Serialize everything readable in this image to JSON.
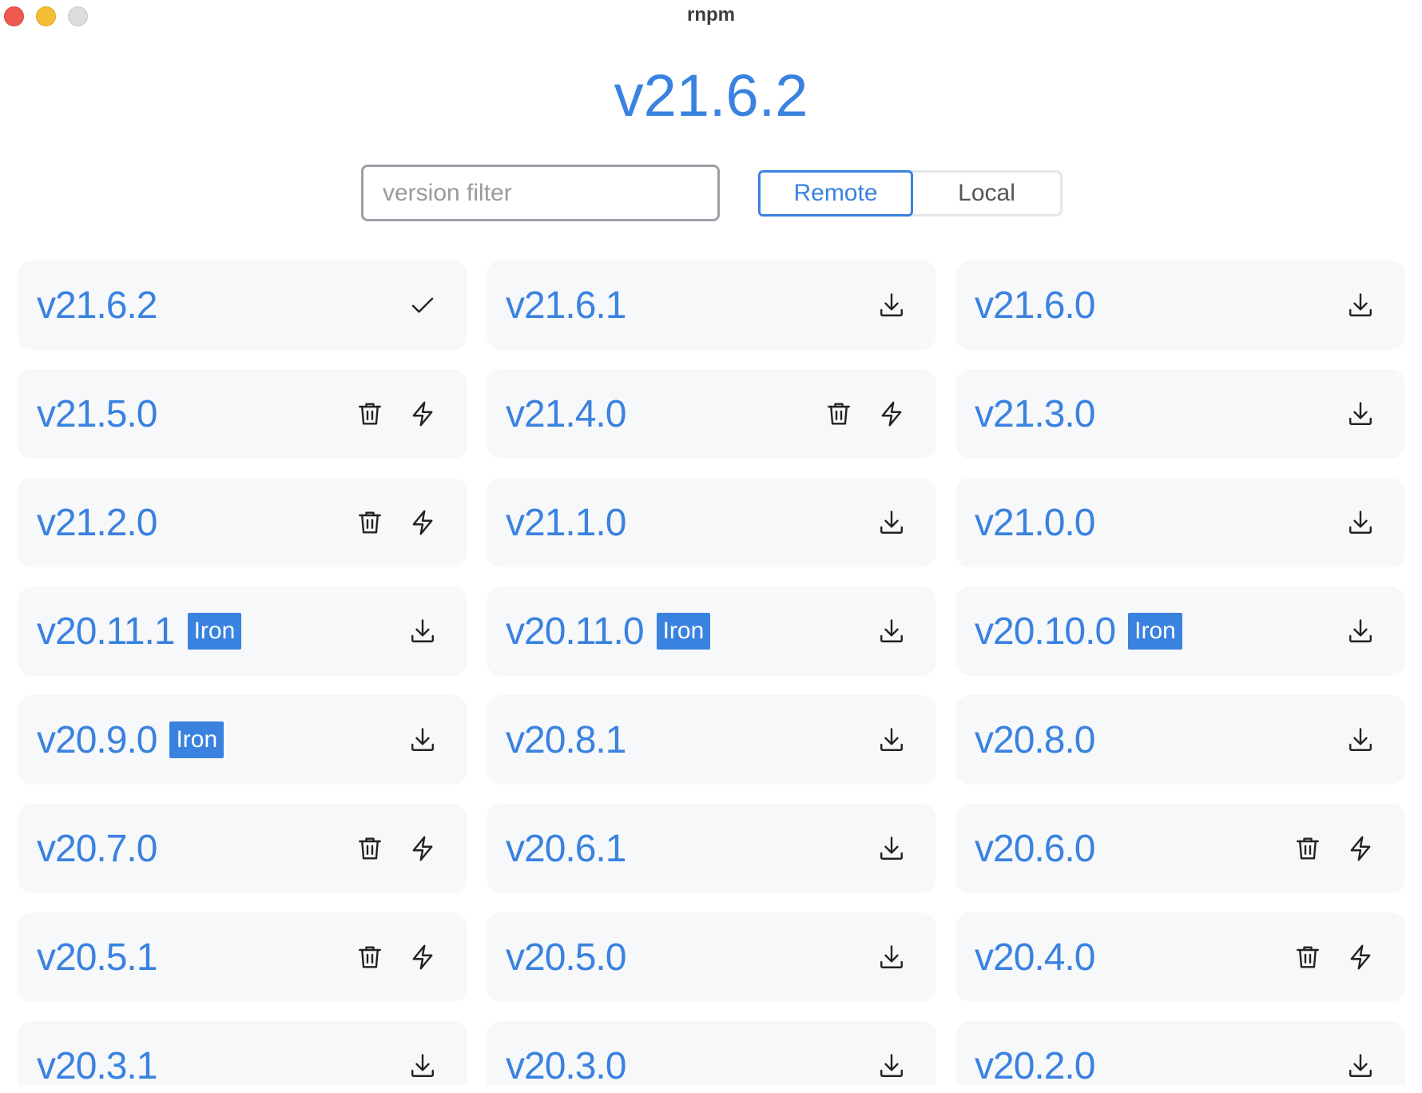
{
  "window": {
    "title": "rnpm"
  },
  "current_version": "v21.6.2",
  "filter": {
    "placeholder": "version filter",
    "value": ""
  },
  "source_toggle": {
    "options": [
      "Remote",
      "Local"
    ],
    "selected": "Remote"
  },
  "colors": {
    "accent": "#3a82e0",
    "card_bg": "#f7f8fa"
  },
  "versions": [
    {
      "label": "v21.6.2",
      "badge": "",
      "status": "current",
      "icons": [
        "check-icon"
      ]
    },
    {
      "label": "v21.6.1",
      "badge": "",
      "status": "remote",
      "icons": [
        "download-icon"
      ]
    },
    {
      "label": "v21.6.0",
      "badge": "",
      "status": "remote",
      "icons": [
        "download-icon"
      ]
    },
    {
      "label": "v21.5.0",
      "badge": "",
      "status": "installed",
      "icons": [
        "trash-icon",
        "bolt-icon"
      ]
    },
    {
      "label": "v21.4.0",
      "badge": "",
      "status": "installed",
      "icons": [
        "trash-icon",
        "bolt-icon"
      ]
    },
    {
      "label": "v21.3.0",
      "badge": "",
      "status": "remote",
      "icons": [
        "download-icon"
      ]
    },
    {
      "label": "v21.2.0",
      "badge": "",
      "status": "installed",
      "icons": [
        "trash-icon",
        "bolt-icon"
      ]
    },
    {
      "label": "v21.1.0",
      "badge": "",
      "status": "remote",
      "icons": [
        "download-icon"
      ]
    },
    {
      "label": "v21.0.0",
      "badge": "",
      "status": "remote",
      "icons": [
        "download-icon"
      ]
    },
    {
      "label": "v20.11.1",
      "badge": "Iron",
      "status": "remote",
      "icons": [
        "download-icon"
      ]
    },
    {
      "label": "v20.11.0",
      "badge": "Iron",
      "status": "remote",
      "icons": [
        "download-icon"
      ]
    },
    {
      "label": "v20.10.0",
      "badge": "Iron",
      "status": "remote",
      "icons": [
        "download-icon"
      ]
    },
    {
      "label": "v20.9.0",
      "badge": "Iron",
      "status": "remote",
      "icons": [
        "download-icon"
      ]
    },
    {
      "label": "v20.8.1",
      "badge": "",
      "status": "remote",
      "icons": [
        "download-icon"
      ]
    },
    {
      "label": "v20.8.0",
      "badge": "",
      "status": "remote",
      "icons": [
        "download-icon"
      ]
    },
    {
      "label": "v20.7.0",
      "badge": "",
      "status": "installed",
      "icons": [
        "trash-icon",
        "bolt-icon"
      ]
    },
    {
      "label": "v20.6.1",
      "badge": "",
      "status": "remote",
      "icons": [
        "download-icon"
      ]
    },
    {
      "label": "v20.6.0",
      "badge": "",
      "status": "installed",
      "icons": [
        "trash-icon",
        "bolt-icon"
      ]
    },
    {
      "label": "v20.5.1",
      "badge": "",
      "status": "installed",
      "icons": [
        "trash-icon",
        "bolt-icon"
      ]
    },
    {
      "label": "v20.5.0",
      "badge": "",
      "status": "remote",
      "icons": [
        "download-icon"
      ]
    },
    {
      "label": "v20.4.0",
      "badge": "",
      "status": "installed",
      "icons": [
        "trash-icon",
        "bolt-icon"
      ]
    },
    {
      "label": "v20.3.1",
      "badge": "",
      "status": "remote",
      "icons": [
        "download-icon"
      ]
    },
    {
      "label": "v20.3.0",
      "badge": "",
      "status": "remote",
      "icons": [
        "download-icon"
      ]
    },
    {
      "label": "v20.2.0",
      "badge": "",
      "status": "remote",
      "icons": [
        "download-icon"
      ]
    }
  ]
}
